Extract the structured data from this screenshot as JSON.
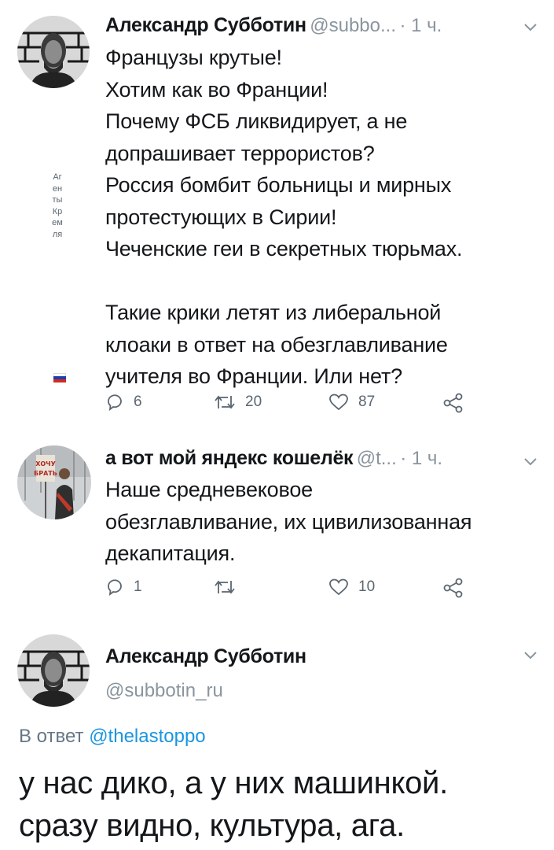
{
  "tweet1": {
    "author_name": "Александр Субботин",
    "author_handle": "@subbo...",
    "time": "· 1 ч.",
    "text": "Французы крутые!\nХотим как во Франции!\nПочему ФСБ ликвидирует, а не\nдопрашивает террористов?\nРоссия бомбит больницы и мирных\nпротестующих в Сирии!\nЧеченские геи в секретных тюрьмах.\n\nТакие крики летят из либеральной\nклоаки в ответ на обезглавливание\nучителя во Франции. Или нет?",
    "replies": "6",
    "retweets": "20",
    "likes": "87"
  },
  "side_label": "Агенты Кремля",
  "tweet2": {
    "author_name": "а вот мой яндекс кошелёк",
    "author_handle": "@t...",
    "time": "· 1 ч.",
    "avatar_sign": "ХОЧУ БРАТЬ",
    "text": "Наше средневековое\nобезглавливание, их цивилизованная\nдекапитация.",
    "replies": "1",
    "retweets": "",
    "likes": "10"
  },
  "tweet3": {
    "author_name": "Александр Субботин",
    "author_handle": "@subbotin_ru",
    "reply_prefix": "В ответ",
    "reply_to": "@thelastoppo",
    "text": "у нас дико, а у них машинкой.\nсразу видно, культура, ага."
  },
  "colors": {
    "text": "#14171a",
    "secondary": "#8a959e",
    "link": "#1b95e0"
  }
}
